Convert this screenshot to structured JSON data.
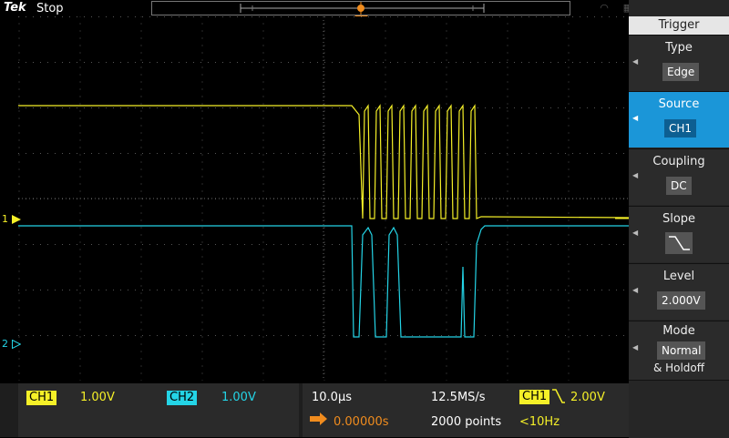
{
  "topbar": {
    "logo": "Tek",
    "run_state": "Stop",
    "trigger_marker": "T"
  },
  "channel_markers": {
    "ch1": "1",
    "ch2": "2"
  },
  "colors": {
    "ch1": "#f5f028",
    "ch2": "#24d4e6",
    "trigger": "#f08c1e",
    "accent": "#1b96d8"
  },
  "bottombar": {
    "ch1": {
      "label": "CH1",
      "scale": "1.00V"
    },
    "ch2": {
      "label": "CH2",
      "scale": "1.00V"
    },
    "timebase": "10.0µs",
    "sample_rate": "12.5MS/s",
    "position": "0.00000s",
    "record_length": "2000 points",
    "trigger": {
      "source": "CH1",
      "level": "2.00V",
      "frequency": "<10Hz"
    }
  },
  "trigger_menu": {
    "title": "Trigger",
    "items": [
      {
        "label": "Type",
        "value": "Edge"
      },
      {
        "label": "Source",
        "value": "CH1",
        "active": true
      },
      {
        "label": "Coupling",
        "value": "DC"
      },
      {
        "label": "Slope",
        "value": "falling",
        "icon": "falling-edge-icon"
      },
      {
        "label": "Level",
        "value": "2.000V"
      },
      {
        "label": "Mode",
        "value": "Normal",
        "value2": "& Holdoff"
      }
    ]
  }
}
